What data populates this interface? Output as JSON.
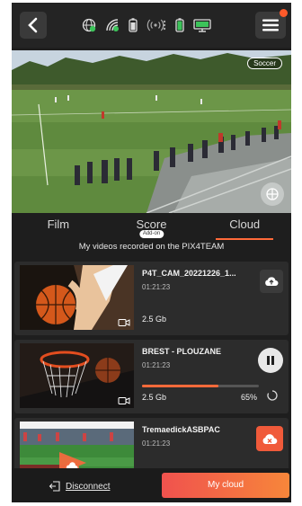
{
  "header": {
    "status_icons": [
      "globe-check-icon",
      "wifi-check-icon",
      "battery-icon",
      "broadcast-icon",
      "battery-green-icon",
      "display-icon"
    ]
  },
  "video": {
    "sport_badge": "Soccer"
  },
  "tabs": [
    {
      "label": "Film",
      "active": false
    },
    {
      "label": "Score",
      "active": false,
      "badge": "Add-on"
    },
    {
      "label": "Cloud",
      "active": true
    }
  ],
  "section_title": "My videos recorded on the PIX4TEAM",
  "videos": [
    {
      "title": "P4T_CAM_20221226_1...",
      "duration": "01:21:23",
      "size": "2.5 Gb",
      "action": "upload-icon"
    },
    {
      "title": "BREST - PLOUZANE",
      "duration": "01:21:23",
      "size": "2.5 Gb",
      "progress": 65,
      "progress_label": "65%",
      "action": "pause-icon"
    },
    {
      "title": "TremaedickASBPAC",
      "duration": "01:21:23",
      "action": "cloud-error-icon"
    }
  ],
  "footer": {
    "disconnect_label": "Disconnect",
    "mycloud_label": "My cloud"
  },
  "colors": {
    "accent": "#ff6a3a",
    "background": "#1e1e1e",
    "card": "#2c2c2c"
  }
}
